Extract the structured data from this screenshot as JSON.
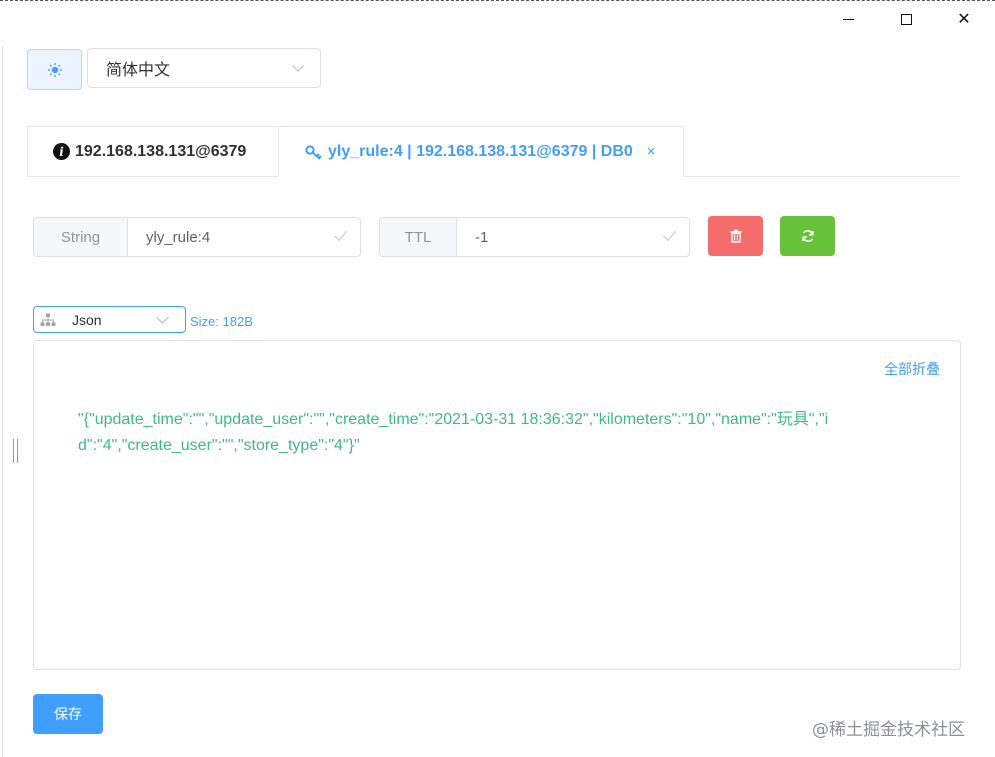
{
  "window": {
    "min_icon": "minimize-icon",
    "max_icon": "maximize-icon",
    "close_glyph": "✕"
  },
  "toolbar": {
    "theme_icon": "theme-toggle-icon",
    "language": "简体中文"
  },
  "tabs": [
    {
      "label": "192.168.138.131@6379",
      "icon": "info-icon"
    },
    {
      "label": "yly_rule:4 | 192.168.138.131@6379 | DB0",
      "icon": "key-icon",
      "close": "×",
      "active": true
    }
  ],
  "key": {
    "type_label": "String",
    "name": "yly_rule:4",
    "ttl_label": "TTL",
    "ttl_value": "-1",
    "delete_icon": "trash-icon",
    "refresh_icon": "refresh-icon"
  },
  "format": {
    "selected": "Json",
    "size_text": "Size: 182B"
  },
  "editor": {
    "collapse_all": "全部折叠",
    "content": "\"{\"update_time\":\"\",\"update_user\":\"\",\"create_time\":\"2021-03-31 18:36:32\",\"kilometers\":\"10\",\"name\":\"玩具\",\"id\":\"4\",\"create_user\":\"\",\"store_type\":\"4\"}\""
  },
  "actions": {
    "save": "保存"
  },
  "watermark": "@稀土掘金技术社区",
  "colors": {
    "primary": "#409eff",
    "danger": "#f56c6c",
    "success": "#67c23a",
    "json_string": "#42b983"
  }
}
